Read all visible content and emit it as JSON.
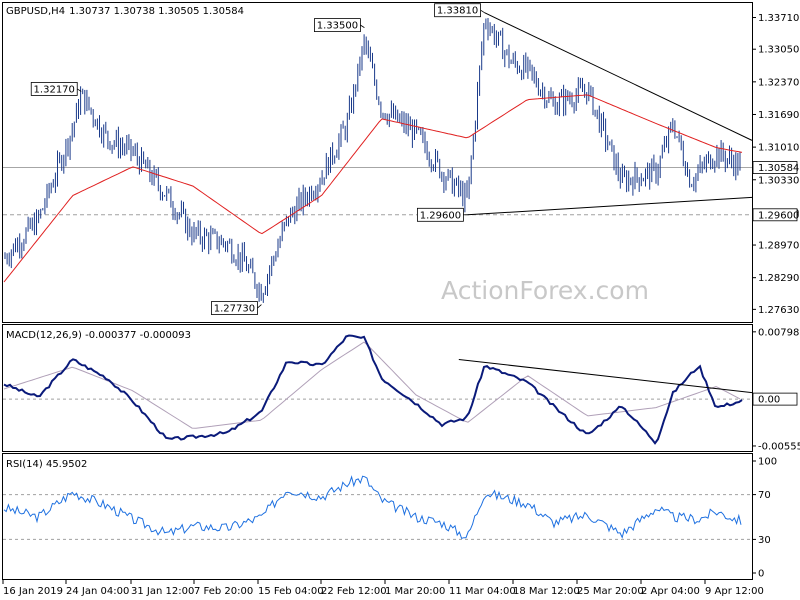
{
  "header": {
    "symbol": "GBPUSD,H4",
    "ohlc": "1.30737 1.30738 1.30505 1.30584"
  },
  "watermark": "ActionForex.com",
  "colors": {
    "candle": "#1a3a8a",
    "ma": "#e02020",
    "macd": "#0a1a7a",
    "signal": "#b0a0b8",
    "rsi": "#1e70e0",
    "grid": "#a0a0a0",
    "trendline": "#000000"
  },
  "chart_data": [
    {
      "type": "candlestick",
      "title": "GBPUSD,H4",
      "ylim": [
        1.2745,
        1.3395
      ],
      "y_ticks": [
        "1.33710",
        "1.33050",
        "1.32370",
        "1.31690",
        "1.31010",
        "1.30330",
        "1.29650",
        "1.28970",
        "1.28290",
        "1.27630"
      ],
      "price_label": "1.30584",
      "level_line": {
        "value": 1.296,
        "label": "1.29600"
      },
      "annotations": [
        {
          "label": "1.32170",
          "value": 1.3217,
          "date": "25 Jan 2019"
        },
        {
          "label": "1.33500",
          "value": 1.335,
          "date": "27 Feb 2019"
        },
        {
          "label": "1.33810",
          "value": 1.3381,
          "date": "13 Mar 2019"
        },
        {
          "label": "1.29600",
          "value": 1.296,
          "date": "11 Mar 2019"
        },
        {
          "label": "1.27730",
          "value": 1.2773,
          "date": "15 Feb 2019"
        }
      ],
      "trendlines": [
        {
          "from": {
            "date": "13 Mar 2019",
            "value": 1.3381
          },
          "to": {
            "date": "12 Apr 2019",
            "value": 1.3125
          }
        },
        {
          "from": {
            "date": "11 Mar 2019",
            "value": 1.296
          },
          "to": {
            "date": "12 Apr 2019",
            "value": 1.2995
          }
        }
      ],
      "series": [
        {
          "kind": "price",
          "x": [
            "16 Jan 2019",
            "20 Jan 2019",
            "24 Jan 2019",
            "25 Jan 2019",
            "28 Jan 2019",
            "31 Jan 2019",
            "4 Feb 2019",
            "7 Feb 2019",
            "11 Feb 2019",
            "13 Feb 2019",
            "15 Feb 2019",
            "18 Feb 2019",
            "22 Feb 2019",
            "25 Feb 2019",
            "27 Feb 2019",
            "1 Mar 2019",
            "5 Mar 2019",
            "8 Mar 2019",
            "11 Mar 2019",
            "13 Mar 2019",
            "16 Mar 2019",
            "18 Mar 2019",
            "21 Mar 2019",
            "25 Mar 2019",
            "29 Mar 2019",
            "2 Apr 2019",
            "4 Apr 2019",
            "6 Apr 2019",
            "9 Apr 2019",
            "12 Apr 2019"
          ],
          "values": [
            1.287,
            1.295,
            1.314,
            1.321,
            1.312,
            1.309,
            1.3,
            1.292,
            1.29,
            1.286,
            1.28,
            1.295,
            1.304,
            1.315,
            1.332,
            1.318,
            1.313,
            1.305,
            1.299,
            1.337,
            1.328,
            1.326,
            1.319,
            1.322,
            1.303,
            1.305,
            1.315,
            1.303,
            1.309,
            1.306
          ]
        },
        {
          "kind": "ma",
          "x": [
            "16 Jan 2019",
            "24 Jan 2019",
            "31 Jan 2019",
            "7 Feb 2019",
            "15 Feb 2019",
            "22 Feb 2019",
            "1 Mar 2019",
            "11 Mar 2019",
            "18 Mar 2019",
            "25 Mar 2019",
            "2 Apr 2019",
            "9 Apr 2019",
            "12 Apr 2019"
          ],
          "values": [
            1.282,
            1.3,
            1.306,
            1.302,
            1.292,
            1.3,
            1.316,
            1.312,
            1.32,
            1.321,
            1.315,
            1.31,
            1.309
          ]
        }
      ]
    },
    {
      "type": "line",
      "title": "MACD(12,26,9) -0.000377 -0.000093",
      "ylim": [
        -0.0058,
        0.0082
      ],
      "y_ticks": [
        {
          "label": "0.007983",
          "value": 0.007983
        },
        {
          "label": "0.00",
          "value": 0.0
        },
        {
          "label": "-0.005559",
          "value": -0.005559
        }
      ],
      "zero_label": "0.00",
      "trendline": {
        "from": {
          "date": "10 Mar 2019",
          "value": 0.0047
        },
        "to": {
          "date": "12 Apr 2019",
          "value": 0.0009
        }
      },
      "series": [
        {
          "name": "",
          "x": [
            "16 Jan 2019",
            "20 Jan 2019",
            "24 Jan 2019",
            "28 Jan 2019",
            "31 Jan 2019",
            "4 Feb 2019",
            "7 Feb 2019",
            "11 Feb 2019",
            "15 Feb 2019",
            "18 Feb 2019",
            "22 Feb 2019",
            "25 Feb 2019",
            "27 Feb 2019",
            "1 Mar 2019",
            "5 Mar 2019",
            "8 Mar 2019",
            "11 Mar 2019",
            "13 Mar 2019",
            "18 Mar 2019",
            "21 Mar 2019",
            "25 Mar 2019",
            "29 Mar 2019",
            "2 Apr 2019",
            "4 Apr 2019",
            "7 Apr 2019",
            "9 Apr 2019",
            "12 Apr 2019"
          ],
          "values": [
            0.0018,
            0.0002,
            0.0047,
            0.0025,
            -0.0002,
            -0.0048,
            -0.0045,
            -0.004,
            -0.0015,
            0.0045,
            0.004,
            0.0075,
            0.0072,
            0.0025,
            -0.0005,
            -0.003,
            -0.0022,
            0.004,
            0.002,
            -0.0008,
            -0.0043,
            -0.0008,
            -0.0052,
            0.0008,
            0.004,
            -0.001,
            -0.0002
          ]
        },
        {
          "name": "",
          "x": [
            "16 Jan 2019",
            "24 Jan 2019",
            "31 Jan 2019",
            "7 Feb 2019",
            "15 Feb 2019",
            "22 Feb 2019",
            "27 Feb 2019",
            "5 Mar 2019",
            "11 Mar 2019",
            "18 Mar 2019",
            "25 Mar 2019",
            "2 Apr 2019",
            "9 Apr 2019",
            "12 Apr 2019"
          ],
          "values": [
            0.0012,
            0.0038,
            0.001,
            -0.0035,
            -0.0025,
            0.0035,
            0.0068,
            0.0005,
            -0.0028,
            0.0028,
            -0.002,
            -0.001,
            0.0015,
            -0.0001
          ]
        }
      ]
    },
    {
      "type": "line",
      "title": "RSI(14) 45.9502",
      "ylim": [
        0,
        100
      ],
      "y_ticks": [
        {
          "label": "100",
          "value": 100
        },
        {
          "label": "70",
          "value": 70
        },
        {
          "label": "30",
          "value": 30
        },
        {
          "label": "0",
          "value": 0
        }
      ],
      "x_labels": [
        "16 Jan 2019",
        "24 Jan 04:00",
        "31 Jan 12:00",
        "7 Feb 20:00",
        "15 Feb 04:00",
        "22 Feb 12:00",
        "1 Mar 20:00",
        "11 Mar 04:00",
        "18 Mar 12:00",
        "25 Mar 20:00",
        "2 Apr 04:00",
        "9 Apr 12:00"
      ],
      "series": [
        {
          "name": "",
          "x": [
            "16 Jan 2019",
            "20 Jan 2019",
            "24 Jan 2019",
            "28 Jan 2019",
            "31 Jan 2019",
            "4 Feb 2019",
            "7 Feb 2019",
            "11 Feb 2019",
            "15 Feb 2019",
            "18 Feb 2019",
            "22 Feb 2019",
            "25 Feb 2019",
            "27 Feb 2019",
            "1 Mar 2019",
            "5 Mar 2019",
            "8 Mar 2019",
            "11 Mar 2019",
            "13 Mar 2019",
            "18 Mar 2019",
            "21 Mar 2019",
            "25 Mar 2019",
            "29 Mar 2019",
            "2 Apr 2019",
            "4 Apr 2019",
            "7 Apr 2019",
            "9 Apr 2019",
            "12 Apr 2019"
          ],
          "values": [
            58,
            50,
            72,
            60,
            48,
            35,
            42,
            40,
            50,
            75,
            68,
            80,
            85,
            65,
            50,
            45,
            32,
            72,
            62,
            45,
            52,
            35,
            58,
            50,
            48,
            55,
            46
          ]
        }
      ]
    }
  ]
}
